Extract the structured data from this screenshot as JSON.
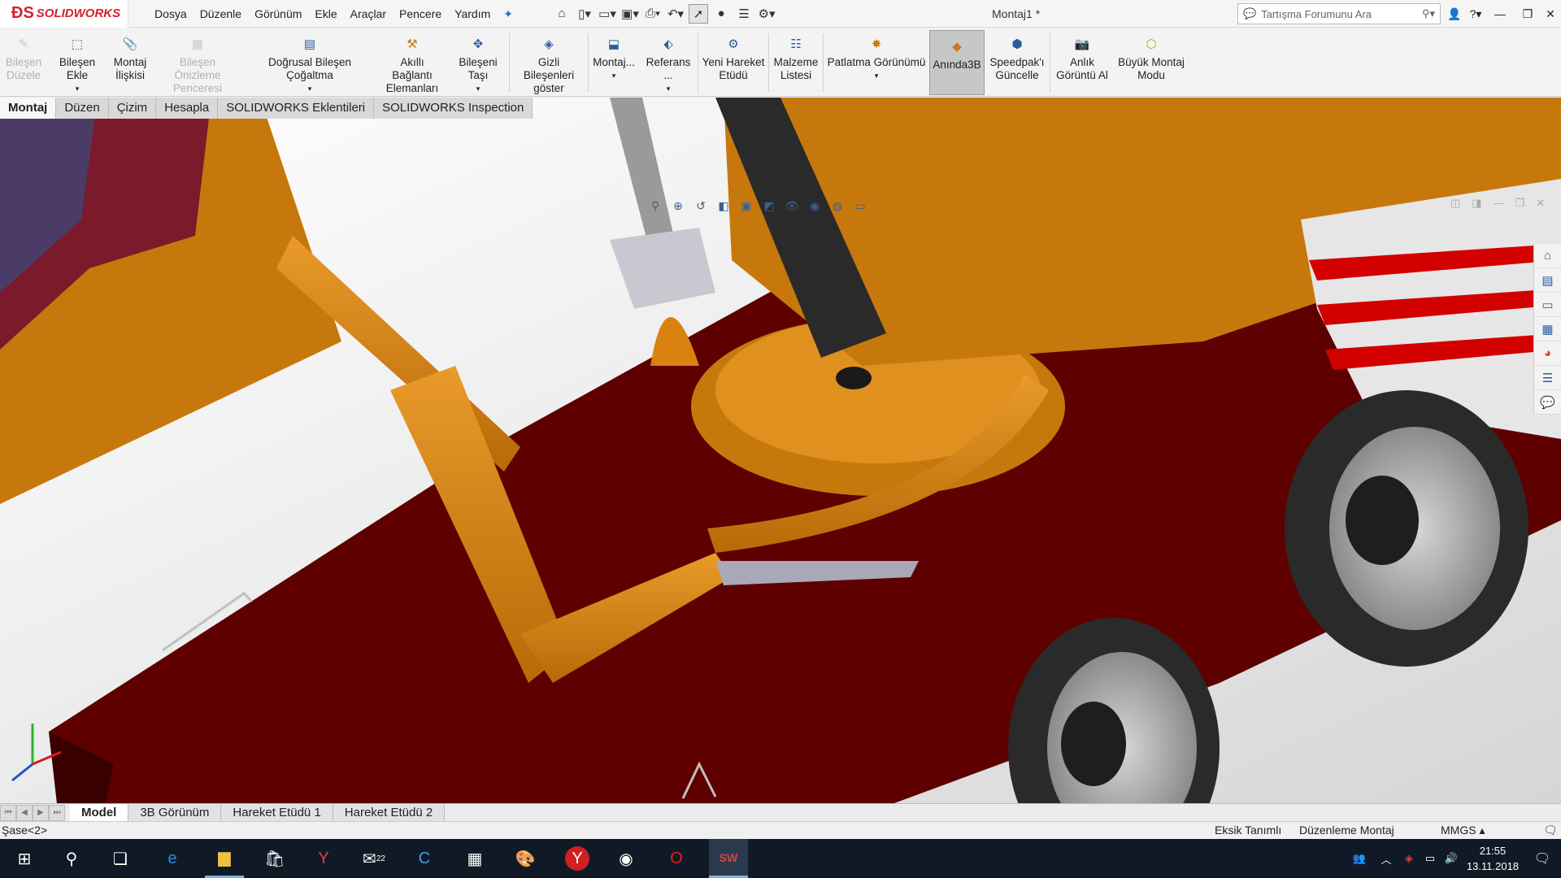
{
  "app": {
    "logo_text": "SOLIDWORKS",
    "document_title": "Montaj1 *"
  },
  "menu": [
    "Dosya",
    "Düzenle",
    "Görünüm",
    "Ekle",
    "Araçlar",
    "Pencere",
    "Yardım"
  ],
  "search": {
    "placeholder": "Tartışma Forumunu Ara"
  },
  "commands": [
    {
      "label": "Bileşen Düzele",
      "icon": "edit-component-icon",
      "disabled": true
    },
    {
      "label": "Bileşen Ekle",
      "icon": "insert-component-icon",
      "disabled": false,
      "dropdown": true
    },
    {
      "label": "Montaj İlişkisi",
      "icon": "mate-icon",
      "disabled": false
    },
    {
      "label": "Bileşen Önizleme Penceresi",
      "icon": "component-preview-icon",
      "disabled": true
    },
    {
      "label": "Doğrusal Bileşen Çoğaltma",
      "icon": "linear-pattern-icon",
      "disabled": false,
      "dropdown": true
    },
    {
      "label": "Akıllı Bağlantı Elemanları",
      "icon": "smart-fasteners-icon",
      "disabled": false
    },
    {
      "label": "Bileşeni Taşı",
      "icon": "move-component-icon",
      "disabled": false,
      "dropdown": true
    },
    {
      "label": "Gizli Bileşenleri göster",
      "icon": "show-hidden-icon",
      "disabled": false
    },
    {
      "label": "Montaj...",
      "icon": "assembly-features-icon",
      "disabled": false,
      "dropdown": true
    },
    {
      "label": "Referans ...",
      "icon": "reference-geometry-icon",
      "disabled": false,
      "dropdown": true
    },
    {
      "label": "Yeni Hareket Etüdü",
      "icon": "new-motion-study-icon",
      "disabled": false
    },
    {
      "label": "Malzeme Listesi",
      "icon": "bill-of-materials-icon",
      "disabled": false
    },
    {
      "label": "Patlatma Görünümü",
      "icon": "exploded-view-icon",
      "disabled": false,
      "dropdown": true
    },
    {
      "label": "Anında3B",
      "icon": "instant3d-icon",
      "disabled": false,
      "active": true
    },
    {
      "label": "Speedpak'ı Güncelle",
      "icon": "speedpak-icon",
      "disabled": false
    },
    {
      "label": "Anlık Görüntü Al",
      "icon": "snapshot-icon",
      "disabled": false
    },
    {
      "label": "Büyük Montaj Modu",
      "icon": "large-assembly-icon",
      "disabled": false
    }
  ],
  "tabs": [
    "Montaj",
    "Düzen",
    "Çizim",
    "Hesapla",
    "SOLIDWORKS Eklentileri",
    "SOLIDWORKS Inspection"
  ],
  "active_tab": "Montaj",
  "bottom_tabs": [
    "Model",
    "3B Görünüm",
    "Hareket Etüdü 1",
    "Hareket Etüdü 2"
  ],
  "active_bottom_tab": "Model",
  "status": {
    "selection": "Şase<2>",
    "definition": "Eksik Tanımlı",
    "mode": "Düzenleme Montaj",
    "units": "MMGS"
  },
  "taskbar": {
    "mail_badge": "22",
    "clock_time": "21:55",
    "clock_date": "13.11.2018"
  },
  "colors": {
    "orange_part": "#d9820f",
    "dark_red_chassis": "#5e0000",
    "tire": "#2a2a2a",
    "rim": "#b0b0b0",
    "brand_red": "#d7202e",
    "taskbar": "#101a26"
  }
}
